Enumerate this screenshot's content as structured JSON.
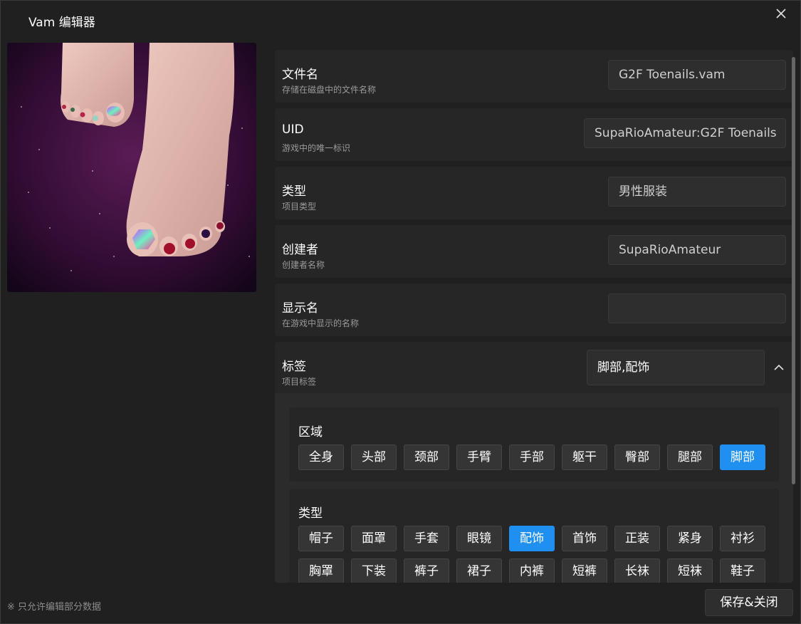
{
  "window": {
    "title": "Vam 编辑器"
  },
  "preview": {
    "alt": "G2F Toenails preview"
  },
  "fields": [
    {
      "label": "文件名",
      "sublabel": "存储在磁盘中的文件名称",
      "value": "G2F Toenails.vam",
      "placeholder": ""
    },
    {
      "label": "UID",
      "sublabel": "游戏中的唯一标识",
      "value": "SupaRioAmateur:G2F Toenails",
      "placeholder": ""
    },
    {
      "label": "类型",
      "sublabel": "项目类型",
      "value": "男性服装",
      "placeholder": ""
    },
    {
      "label": "创建者",
      "sublabel": "创建者名称",
      "value": "SupaRioAmateur",
      "placeholder": ""
    },
    {
      "label": "显示名",
      "sublabel": "在游戏中显示的名称",
      "value": "",
      "placeholder": ""
    }
  ],
  "tags": {
    "label": "标签",
    "sublabel": "项目标签",
    "value": "脚部,配饰",
    "expanded": true,
    "groups": [
      {
        "title": "区域",
        "chips": [
          {
            "label": "全身",
            "selected": false
          },
          {
            "label": "头部",
            "selected": false
          },
          {
            "label": "颈部",
            "selected": false
          },
          {
            "label": "手臂",
            "selected": false
          },
          {
            "label": "手部",
            "selected": false
          },
          {
            "label": "躯干",
            "selected": false
          },
          {
            "label": "臀部",
            "selected": false
          },
          {
            "label": "腿部",
            "selected": false
          },
          {
            "label": "脚部",
            "selected": true
          }
        ]
      },
      {
        "title": "类型",
        "chips": [
          {
            "label": "帽子",
            "selected": false
          },
          {
            "label": "面罩",
            "selected": false
          },
          {
            "label": "手套",
            "selected": false
          },
          {
            "label": "眼镜",
            "selected": false
          },
          {
            "label": "配饰",
            "selected": true
          },
          {
            "label": "首饰",
            "selected": false
          },
          {
            "label": "正装",
            "selected": false
          },
          {
            "label": "紧身",
            "selected": false
          },
          {
            "label": "衬衫",
            "selected": false
          },
          {
            "label": "胸罩",
            "selected": false
          },
          {
            "label": "下装",
            "selected": false
          },
          {
            "label": "裤子",
            "selected": false
          },
          {
            "label": "裙子",
            "selected": false
          },
          {
            "label": "内裤",
            "selected": false
          },
          {
            "label": "短裤",
            "selected": false
          },
          {
            "label": "长袜",
            "selected": false
          },
          {
            "label": "短袜",
            "selected": false
          },
          {
            "label": "鞋子",
            "selected": false
          }
        ]
      }
    ]
  },
  "footer": {
    "note": "※ 只允许编辑部分数据",
    "save_label": "保存&关闭"
  },
  "colors": {
    "accent": "#1f8ff0",
    "background": "#202020",
    "panel": "#262626"
  },
  "icons": {
    "close": "close-icon",
    "collapse": "chevron-up-icon"
  }
}
